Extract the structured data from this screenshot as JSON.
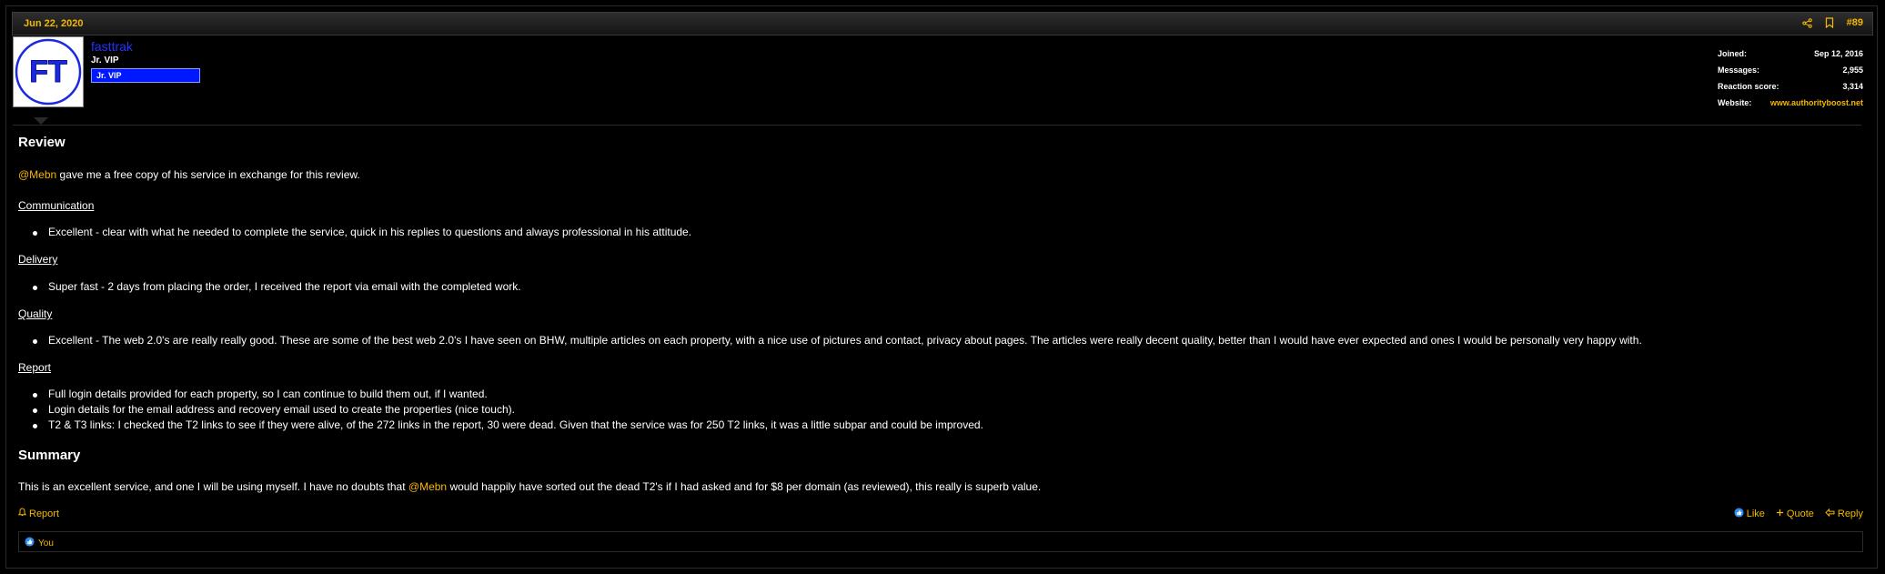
{
  "post": {
    "date": "Jun 22, 2020",
    "number": "#89",
    "share_icon": "share-icon",
    "bookmark_icon": "bookmark-icon"
  },
  "user": {
    "avatar_text": "FT",
    "name": "fasttrak",
    "title": "Jr. VIP",
    "banner": "Jr. VIP",
    "stats": {
      "joined_label": "Joined:",
      "joined": "Sep 12, 2016",
      "messages_label": "Messages:",
      "messages": "2,955",
      "reaction_label": "Reaction score:",
      "reaction": "3,314",
      "website_label": "Website:",
      "website": "www.authorityboost.net"
    }
  },
  "body": {
    "heading_review": "Review",
    "intro_mention": "@Mebn",
    "intro_text": " gave me a free copy of his service in exchange for this review.",
    "communication": "Communication",
    "communication_items": [
      "Excellent - clear with what he needed to complete the service, quick in his replies to questions and always professional in his attitude."
    ],
    "delivery": "Delivery",
    "delivery_items": [
      "Super fast - 2 days from placing the order, I received the report via email with the completed work."
    ],
    "quality": "Quality",
    "quality_items": [
      "Excellent - The web 2.0's are really really good. These are some of the best web 2.0's I have seen on BHW, multiple articles on each property, with a nice use of pictures and contact, privacy about pages. The articles were really decent quality, better than I would have ever expected and ones I would be personally very happy with."
    ],
    "report": "Report",
    "report_items": [
      "Full login details provided for each property, so I can continue to build them out, if I wanted.",
      "Login details for the email address and recovery email used to create the properties (nice touch).",
      "T2 & T3 links: I checked the T2 links to see if they were alive, of the 272 links in the report, 30 were dead. Given that the service was for 250 T2 links, it was a little subpar and could be improved."
    ],
    "heading_summary": "Summary",
    "summary_pre": "This is an excellent service, and one I will be using myself. I have no doubts that ",
    "summary_mention": "@Mebn",
    "summary_post": " would happily have sorted out the dead T2's if I had asked and for $8 per domain (as reviewed), this really is superb value."
  },
  "footer": {
    "report": "Report",
    "like": "Like",
    "quote": "Quote",
    "reply": "Reply",
    "reactions_you": "You"
  }
}
